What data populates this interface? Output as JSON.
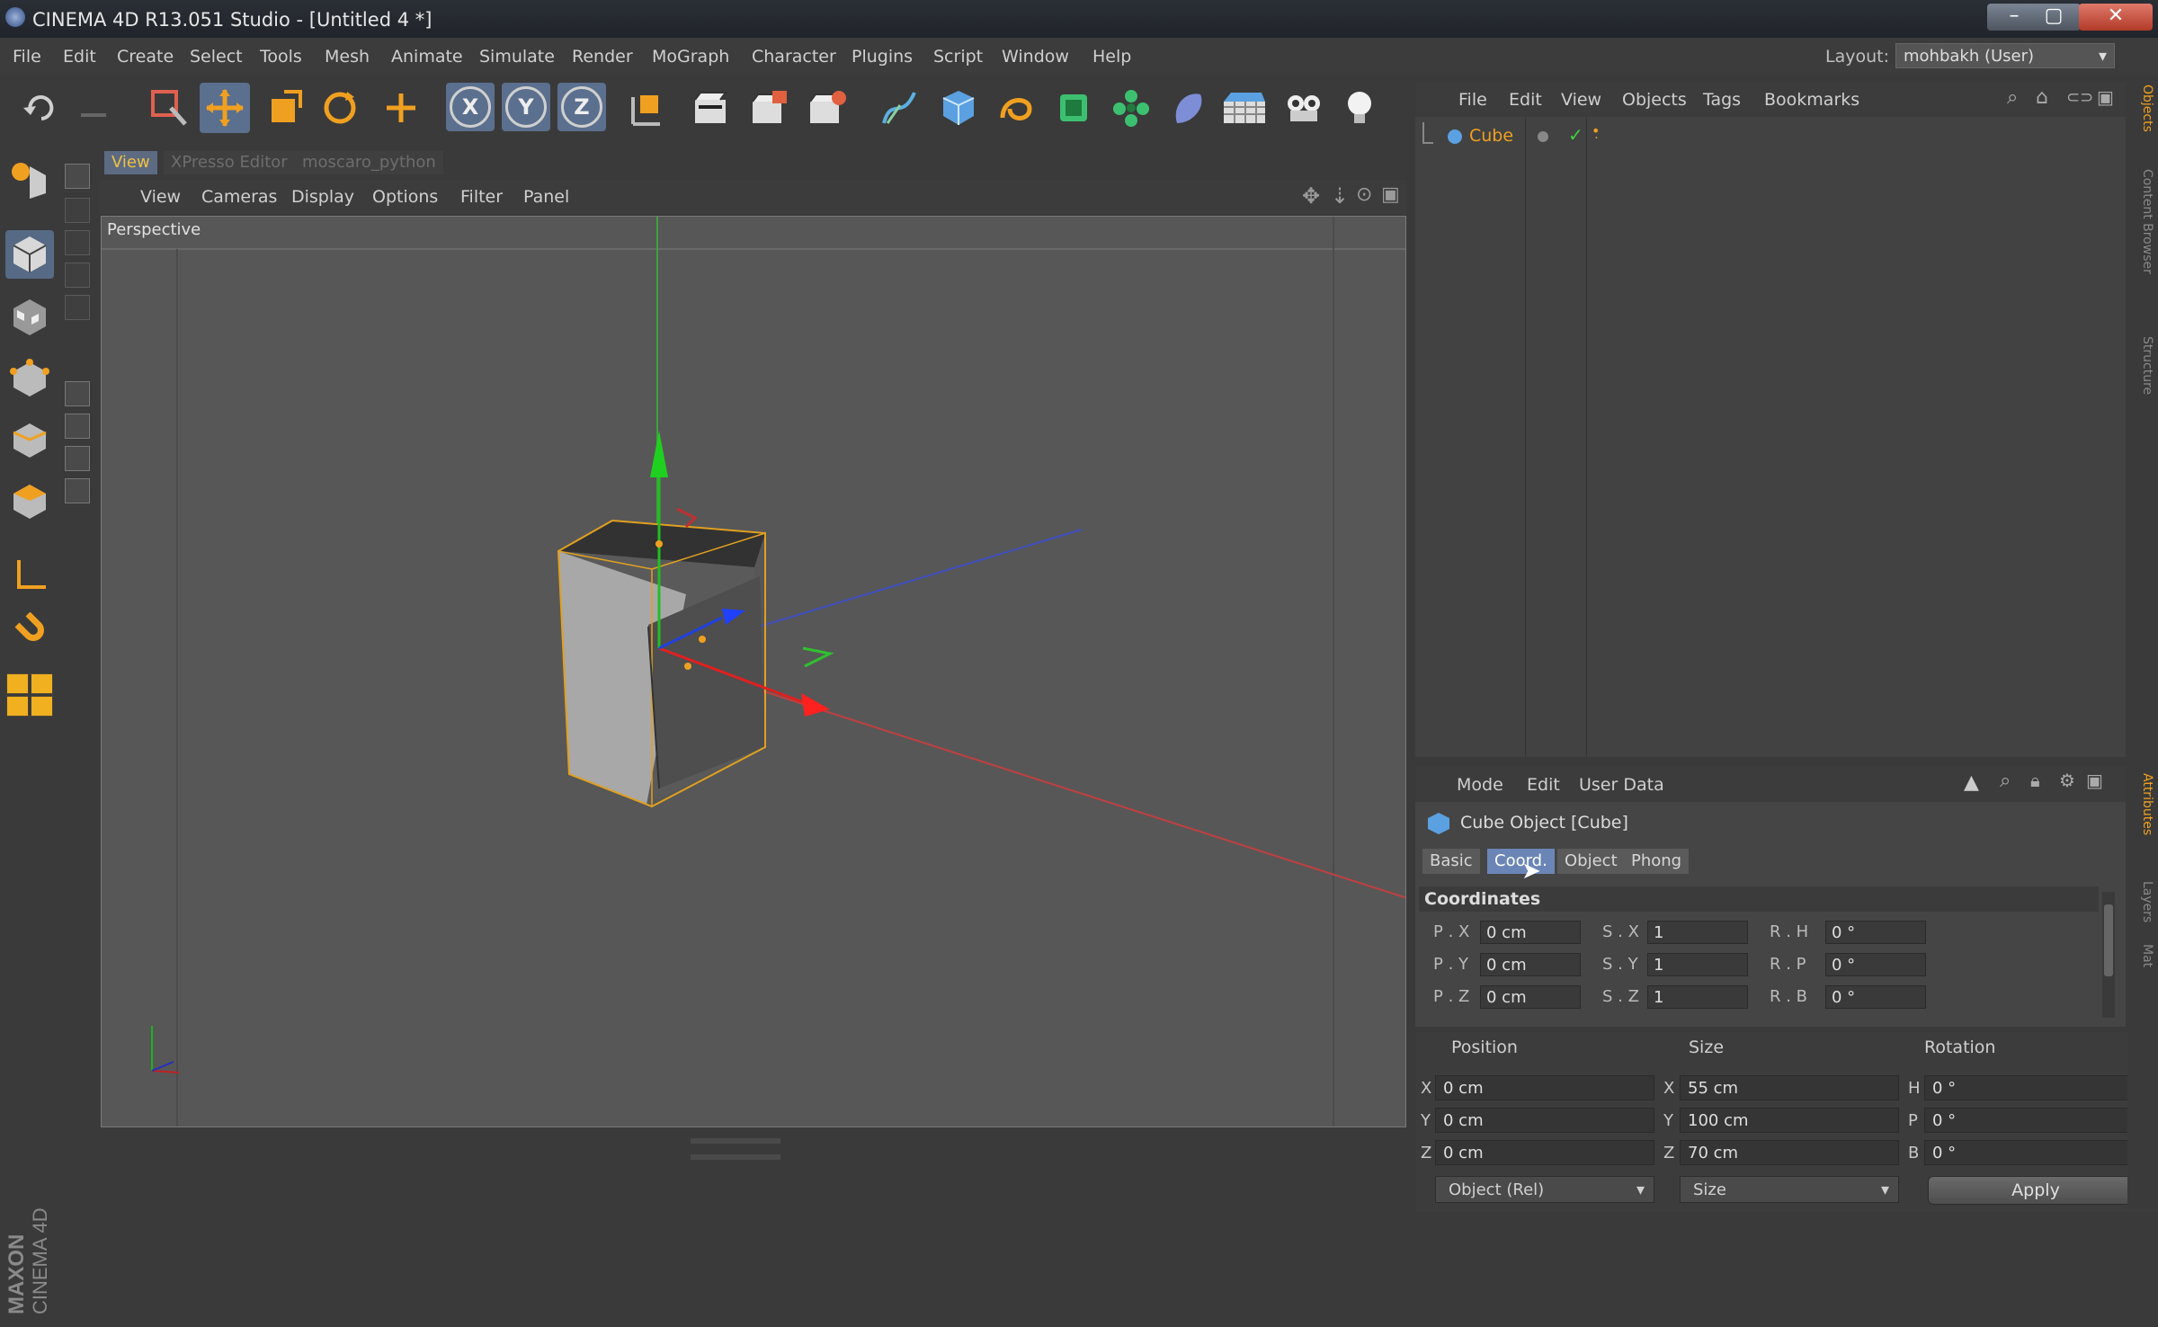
{
  "window": {
    "title": "CINEMA 4D R13.051 Studio - [Untitled 4 *]"
  },
  "menubar": {
    "items": [
      "File",
      "Edit",
      "Create",
      "Select",
      "Tools",
      "Mesh",
      "Animate",
      "Simulate",
      "Render",
      "MoGraph",
      "Character",
      "Plugins",
      "Script",
      "Window",
      "Help"
    ],
    "layout_label": "Layout:",
    "layout_value": "mohbakh (User)"
  },
  "toolbar": {
    "icons": [
      "undo-icon",
      "redo-icon",
      "live-selection-icon",
      "move-icon",
      "scale-icon",
      "rotate-icon",
      "add-object-icon",
      "x-axis-lock-icon",
      "y-axis-lock-icon",
      "z-axis-lock-icon",
      "coordinate-system-icon",
      "render-view-icon",
      "render-to-picture-viewer-icon",
      "render-settings-icon",
      "spline-pen-icon",
      "cube-primitive-icon",
      "nurbs-icon",
      "array-icon",
      "mograph-cloner-icon",
      "deformer-icon",
      "floor-icon",
      "camera-icon",
      "light-icon"
    ],
    "axis_labels": [
      "X",
      "Y",
      "Z"
    ]
  },
  "viewport": {
    "tabs": [
      "View",
      "XPresso Editor",
      "moscaro_python"
    ],
    "menu": [
      "View",
      "Cameras",
      "Display",
      "Options",
      "Filter",
      "Panel"
    ],
    "label": "Perspective"
  },
  "object_manager": {
    "menu": [
      "File",
      "Edit",
      "View",
      "Objects",
      "Tags",
      "Bookmarks"
    ],
    "objects": [
      {
        "name": "Cube"
      }
    ]
  },
  "attribute_manager": {
    "menu": [
      "Mode",
      "Edit",
      "User Data"
    ],
    "title": "Cube Object [Cube]",
    "tabs": [
      "Basic",
      "Coord.",
      "Object",
      "Phong"
    ],
    "active_tab": "Coord.",
    "section": "Coordinates",
    "rows": [
      {
        "p_label": "P . X",
        "p_val": "0 cm",
        "s_label": "S . X",
        "s_val": "1",
        "r_label": "R . H",
        "r_val": "0 °"
      },
      {
        "p_label": "P . Y",
        "p_val": "0 cm",
        "s_label": "S . Y",
        "s_val": "1",
        "r_label": "R . P",
        "r_val": "0 °"
      },
      {
        "p_label": "P . Z",
        "p_val": "0 cm",
        "s_label": "S . Z",
        "s_val": "1",
        "r_label": "R . B",
        "r_val": "0 °"
      }
    ]
  },
  "coordinate_manager": {
    "headers": [
      "Position",
      "Size",
      "Rotation"
    ],
    "rows": [
      {
        "pos_label": "X",
        "pos": "0 cm",
        "size_label": "X",
        "size": "55 cm",
        "rot_label": "H",
        "rot": "0 °"
      },
      {
        "pos_label": "Y",
        "pos": "0 cm",
        "size_label": "Y",
        "size": "100 cm",
        "rot_label": "P",
        "rot": "0 °"
      },
      {
        "pos_label": "Z",
        "pos": "0 cm",
        "size_label": "Z",
        "size": "70 cm",
        "rot_label": "B",
        "rot": "0 °"
      }
    ],
    "mode_select": "Object (Rel)",
    "size_select": "Size",
    "apply_label": "Apply"
  },
  "right_tabs": [
    "Objects",
    "Content Browser",
    "Structure",
    "Attributes",
    "Layers",
    "Mat"
  ],
  "branding": {
    "maxon": "MAXON",
    "product": "CINEMA 4D"
  },
  "colors": {
    "accent": "#f0a020",
    "selection": "#6b86b6",
    "x_axis": "#e02020",
    "y_axis": "#20c020",
    "z_axis": "#2040e0"
  }
}
